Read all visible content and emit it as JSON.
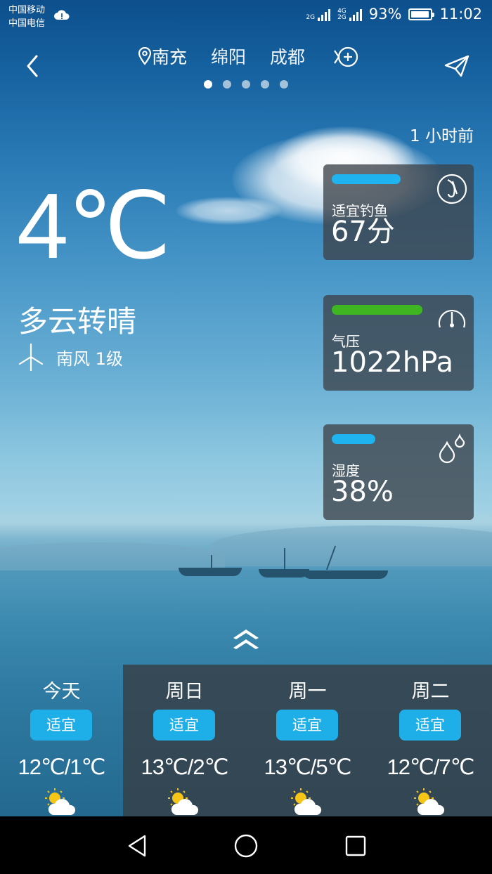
{
  "status_bar": {
    "carrier_1": "中国移动",
    "carrier_2": "中国电信",
    "net_label_1": "2G",
    "net_label_2a": "4G",
    "net_label_2b": "2G",
    "battery": "93%",
    "battery_level": 0.93,
    "time": "11:02",
    "icons": [
      "cloud-icon",
      "signal-icon",
      "battery-icon"
    ]
  },
  "nav": {
    "cities": [
      "南充",
      "绵阳",
      "成都"
    ],
    "active_city_index": 0,
    "page_count": 5,
    "active_page": 0,
    "icons": [
      "back-icon",
      "location-pin-icon",
      "add-city-icon",
      "share-icon"
    ]
  },
  "current": {
    "updated": "1 小时前",
    "temperature": "4℃",
    "condition": "多云转晴",
    "wind": "南风 1级",
    "wind_icon": "wind-turbine-icon"
  },
  "cards": [
    {
      "label": "适宜钓鱼",
      "value": "67分",
      "bar_color": "#1fb3f0",
      "bar_fraction": 0.7,
      "icon": "fishing-hook-icon"
    },
    {
      "label": "气压",
      "value": "1022hPa",
      "bar_color": "#3fb521",
      "bar_fraction": 0.92,
      "icon": "gauge-icon"
    },
    {
      "label": "湿度",
      "value": "38%",
      "bar_color": "#1fb3f0",
      "bar_fraction": 0.44,
      "icon": "droplets-icon"
    }
  ],
  "forecast": [
    {
      "day": "今天",
      "advice": "适宜",
      "range": "12℃/1℃",
      "icon": "partly-cloudy-icon"
    },
    {
      "day": "周日",
      "advice": "适宜",
      "range": "13℃/2℃",
      "icon": "partly-cloudy-icon"
    },
    {
      "day": "周一",
      "advice": "适宜",
      "range": "13℃/5℃",
      "icon": "partly-cloudy-icon"
    },
    {
      "day": "周二",
      "advice": "适宜",
      "range": "12℃/7℃",
      "icon": "partly-cloudy-icon"
    }
  ],
  "accent_colors": {
    "badge": "#1eaee8",
    "card_bg": "#3c424a"
  }
}
